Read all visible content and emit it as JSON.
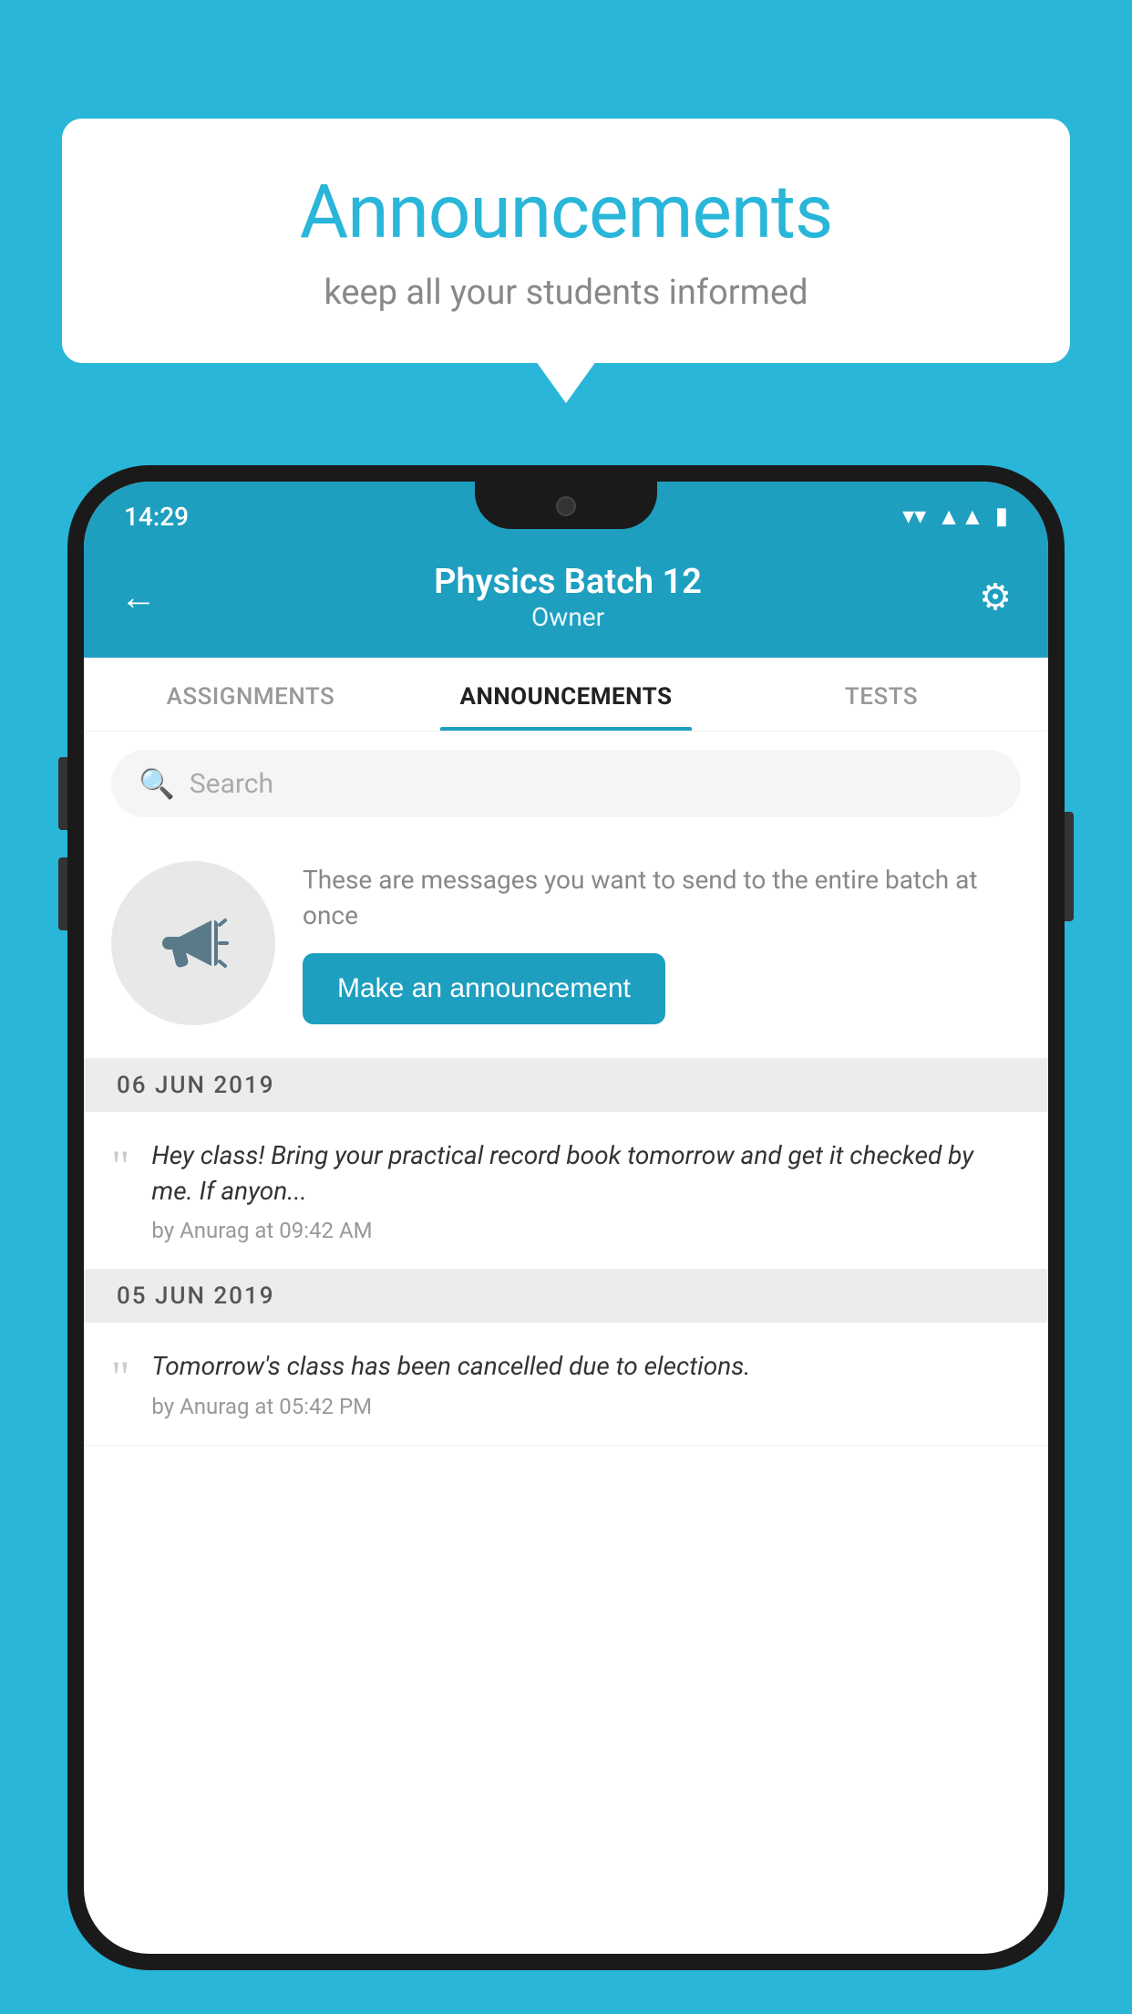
{
  "background_color": "#29b6d8",
  "speech_bubble": {
    "title": "Announcements",
    "subtitle": "keep all your students informed"
  },
  "phone": {
    "status_bar": {
      "time": "14:29",
      "icons": [
        "wifi",
        "signal",
        "battery"
      ]
    },
    "header": {
      "title": "Physics Batch 12",
      "subtitle": "Owner",
      "back_label": "←",
      "gear_label": "⚙"
    },
    "tabs": [
      {
        "label": "ASSIGNMENTS",
        "active": false
      },
      {
        "label": "ANNOUNCEMENTS",
        "active": true
      },
      {
        "label": "TESTS",
        "active": false
      },
      {
        "label": "...",
        "active": false
      }
    ],
    "search": {
      "placeholder": "Search"
    },
    "promo": {
      "description": "These are messages you want to send to the entire batch at once",
      "button_label": "Make an announcement"
    },
    "announcements": [
      {
        "date": "06  JUN  2019",
        "text": "Hey class! Bring your practical record book tomorrow and get it checked by me. If anyon...",
        "meta": "by Anurag at 09:42 AM"
      },
      {
        "date": "05  JUN  2019",
        "text": "Tomorrow's class has been cancelled due to elections.",
        "meta": "by Anurag at 05:42 PM"
      }
    ]
  }
}
